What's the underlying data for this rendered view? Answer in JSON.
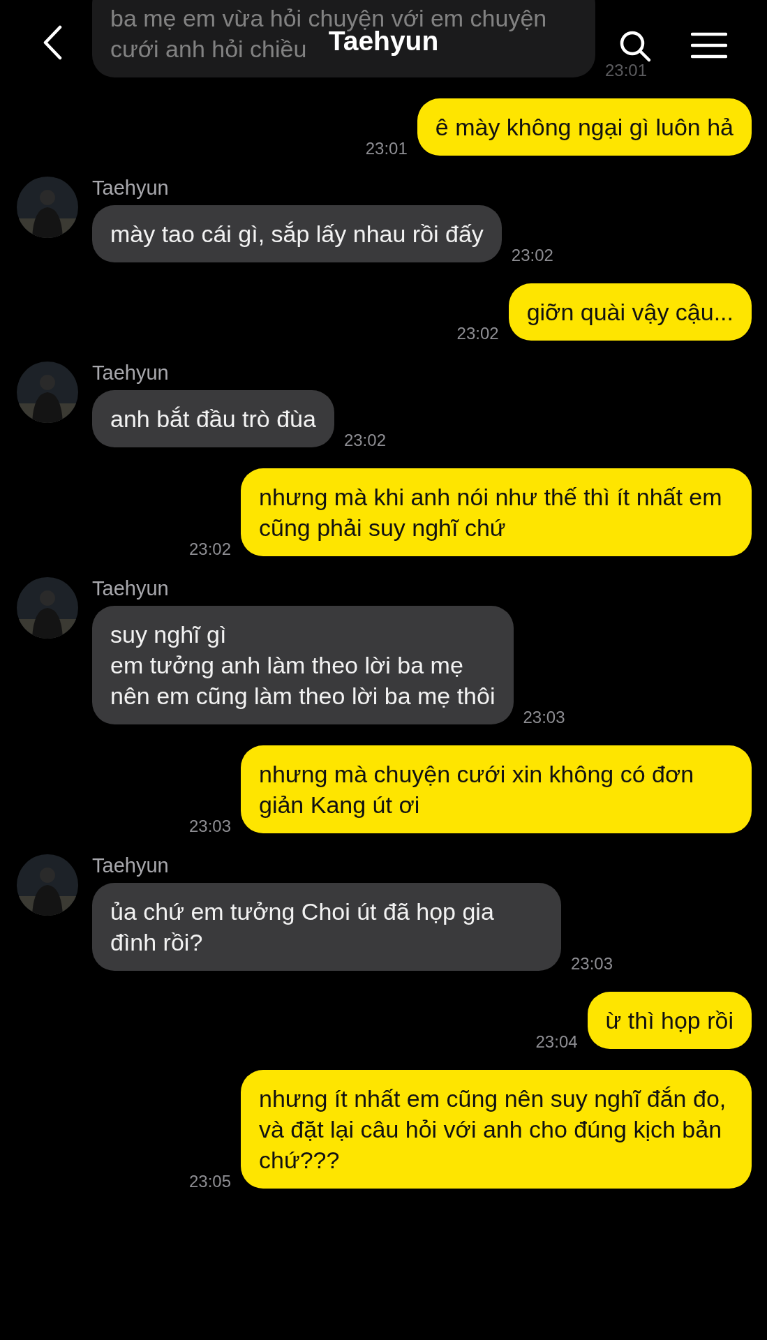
{
  "header": {
    "title": "Taehyun"
  },
  "messages": [
    {
      "kind": "incoming",
      "text": "ba mẹ em vừa hỏi chuyện với em chuyện cưới anh hỏi chiều",
      "time": "23:01"
    },
    {
      "kind": "outgoing",
      "text": "ê mày không ngại gì luôn hả",
      "time": "23:01"
    },
    {
      "kind": "incoming",
      "sender": "Taehyun",
      "text": "mày tao cái gì, sắp lấy nhau rồi đấy",
      "time": "23:02"
    },
    {
      "kind": "outgoing",
      "text": "giỡn quài vậy cậu...",
      "time": "23:02"
    },
    {
      "kind": "incoming",
      "sender": "Taehyun",
      "text": "anh bắt đầu trò đùa",
      "time": "23:02"
    },
    {
      "kind": "outgoing",
      "text": "nhưng mà khi anh nói như thế thì ít nhất em cũng phải suy nghĩ chứ",
      "time": "23:02"
    },
    {
      "kind": "incoming",
      "sender": "Taehyun",
      "text": "suy nghĩ gì\nem tưởng anh làm theo lời ba mẹ\nnên em cũng làm theo lời ba mẹ thôi",
      "time": "23:03"
    },
    {
      "kind": "outgoing",
      "text": "nhưng mà chuyện cưới xin không có đơn giản Kang út ơi",
      "time": "23:03"
    },
    {
      "kind": "incoming",
      "sender": "Taehyun",
      "text": "ủa chứ em tưởng Choi út đã họp gia đình rồi?",
      "time": "23:03"
    },
    {
      "kind": "outgoing",
      "text": "ừ thì họp rồi",
      "time": "23:04"
    },
    {
      "kind": "outgoing",
      "text": "nhưng ít nhất em cũng nên suy nghĩ đắn đo, và đặt lại câu hỏi với anh cho đúng kịch bản chứ???",
      "time": "23:05"
    }
  ]
}
